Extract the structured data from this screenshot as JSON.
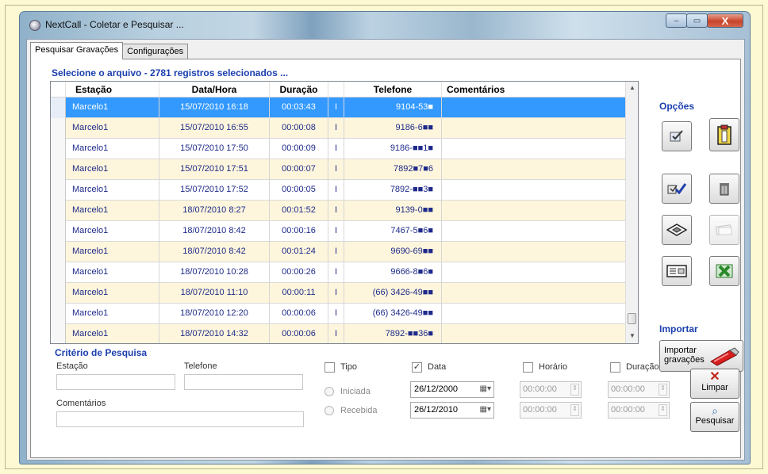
{
  "window": {
    "title": "NextCall - Coletar e Pesquisar ...",
    "minimize": "‒",
    "maximize": "▭",
    "close": "X"
  },
  "tabs": [
    "Pesquisar Gravações",
    "Configurações"
  ],
  "list_title": "Selecione o arquivo - 2781 registros selecionados ...",
  "columns": {
    "estacao": "Estação",
    "data_hora": "Data/Hora",
    "duracao": "Duração",
    "telefone": "Telefone",
    "comentarios": "Comentários"
  },
  "rows": [
    {
      "estacao": "Marcelo1",
      "data_hora": "15/07/2010 16:18",
      "duracao": "00:03:43",
      "tipo": "I",
      "telefone": "9104-53■",
      "comentarios": ""
    },
    {
      "estacao": "Marcelo1",
      "data_hora": "15/07/2010 16:55",
      "duracao": "00:00:08",
      "tipo": "I",
      "telefone": "9186-6■■",
      "comentarios": ""
    },
    {
      "estacao": "Marcelo1",
      "data_hora": "15/07/2010 17:50",
      "duracao": "00:00:09",
      "tipo": "I",
      "telefone": "9186-■■1■",
      "comentarios": ""
    },
    {
      "estacao": "Marcelo1",
      "data_hora": "15/07/2010 17:51",
      "duracao": "00:00:07",
      "tipo": "I",
      "telefone": "7892■7■6",
      "comentarios": ""
    },
    {
      "estacao": "Marcelo1",
      "data_hora": "15/07/2010 17:52",
      "duracao": "00:00:05",
      "tipo": "I",
      "telefone": "7892-■■3■",
      "comentarios": ""
    },
    {
      "estacao": "Marcelo1",
      "data_hora": "18/07/2010 8:27",
      "duracao": "00:01:52",
      "tipo": "I",
      "telefone": "9139-0■■",
      "comentarios": ""
    },
    {
      "estacao": "Marcelo1",
      "data_hora": "18/07/2010 8:42",
      "duracao": "00:00:16",
      "tipo": "I",
      "telefone": "7467-5■6■",
      "comentarios": ""
    },
    {
      "estacao": "Marcelo1",
      "data_hora": "18/07/2010 8:42",
      "duracao": "00:01:24",
      "tipo": "I",
      "telefone": "9690-69■■",
      "comentarios": ""
    },
    {
      "estacao": "Marcelo1",
      "data_hora": "18/07/2010 10:28",
      "duracao": "00:00:26",
      "tipo": "I",
      "telefone": "9666-8■6■",
      "comentarios": ""
    },
    {
      "estacao": "Marcelo1",
      "data_hora": "18/07/2010 11:10",
      "duracao": "00:00:11",
      "tipo": "I",
      "telefone": "(66) 3426-49■■",
      "comentarios": ""
    },
    {
      "estacao": "Marcelo1",
      "data_hora": "18/07/2010 12:20",
      "duracao": "00:00:06",
      "tipo": "I",
      "telefone": "(66) 3426-49■■",
      "comentarios": ""
    },
    {
      "estacao": "Marcelo1",
      "data_hora": "18/07/2010 14:32",
      "duracao": "00:00:06",
      "tipo": "I",
      "telefone": "7892-■■36■",
      "comentarios": ""
    }
  ],
  "options": {
    "title": "Opções",
    "importar_title": "Importar",
    "importar_button": "Importar gravações"
  },
  "criteria": {
    "title": "Critério de Pesquisa",
    "estacao_label": "Estação",
    "estacao_value": "",
    "telefone_label": "Telefone",
    "telefone_value": "",
    "comentarios_label": "Comentários",
    "comentarios_value": "",
    "tipo_label": "Tipo",
    "tipo_checked": false,
    "iniciada_label": "Iniciada",
    "recebida_label": "Recebida",
    "data_label": "Data",
    "data_checked": true,
    "data_from": "26/12/2000",
    "data_to": "26/12/2010",
    "horario_label": "Horário",
    "horario_checked": false,
    "horario_from": "00:00:00",
    "horario_to": "00:00:00",
    "duracao_label": "Duração",
    "duracao_checked": false,
    "duracao_from": "00:00:00",
    "duracao_to": "00:00:00"
  },
  "actions": {
    "limpar": "Limpar",
    "pesquisar": "Pesquisar"
  },
  "colors": {
    "accent_title": "#1b3fae",
    "selected_row": "#3399ff",
    "alt_row": "#fdf6dc",
    "background": "#fdf9d3"
  }
}
